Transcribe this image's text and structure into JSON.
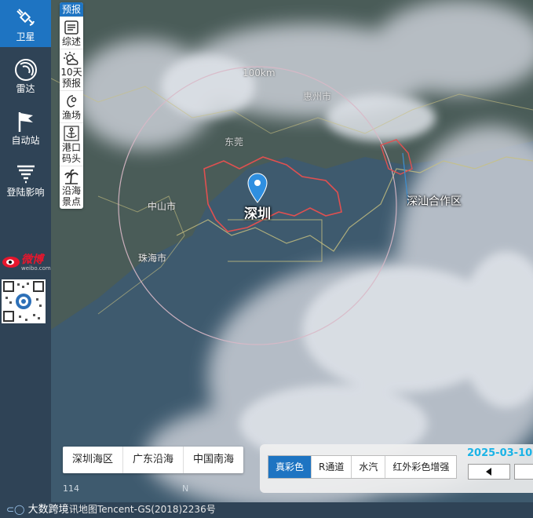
{
  "sidebar": {
    "items": [
      {
        "label": "卫星",
        "icon": "satellite-icon"
      },
      {
        "label": "雷达",
        "icon": "radar-icon"
      },
      {
        "label": "自动站",
        "icon": "flag-icon"
      },
      {
        "label": "登陆影响",
        "icon": "typhoon-icon"
      }
    ],
    "weibo_label": "微博",
    "weibo_domain": "weibo.com"
  },
  "forecast": {
    "header": "预报",
    "items": [
      {
        "label": "综述",
        "icon": "summary-icon"
      },
      {
        "label": "10天预报",
        "icon": "sun-cloud-icon"
      },
      {
        "label": "渔场",
        "icon": "fishing-icon"
      },
      {
        "label": "港口码头",
        "icon": "anchor-icon"
      },
      {
        "label": "沿海景点",
        "icon": "palm-tree-icon"
      }
    ]
  },
  "map": {
    "city_marker": "深圳",
    "range_label": "100km",
    "labels": [
      "中山市",
      "珠海市",
      "深汕合作区",
      "东莞",
      "惠州市"
    ],
    "coord_text": "114",
    "coord_suffix": "N"
  },
  "region_tabs": [
    "深圳海区",
    "广东沿海",
    "中国南海"
  ],
  "products": {
    "items": [
      "真彩色",
      "R通道",
      "水汽",
      "红外彩色增强"
    ],
    "active": "真彩色",
    "date": "2025-03-10"
  },
  "footer": {
    "brand": "大数跨境",
    "copyright": "讯地图Tencent-GS(2018)2236号"
  },
  "colors": {
    "accent": "#1e74c2",
    "sidebar": "#2f4356",
    "date": "#1ab3e6"
  }
}
